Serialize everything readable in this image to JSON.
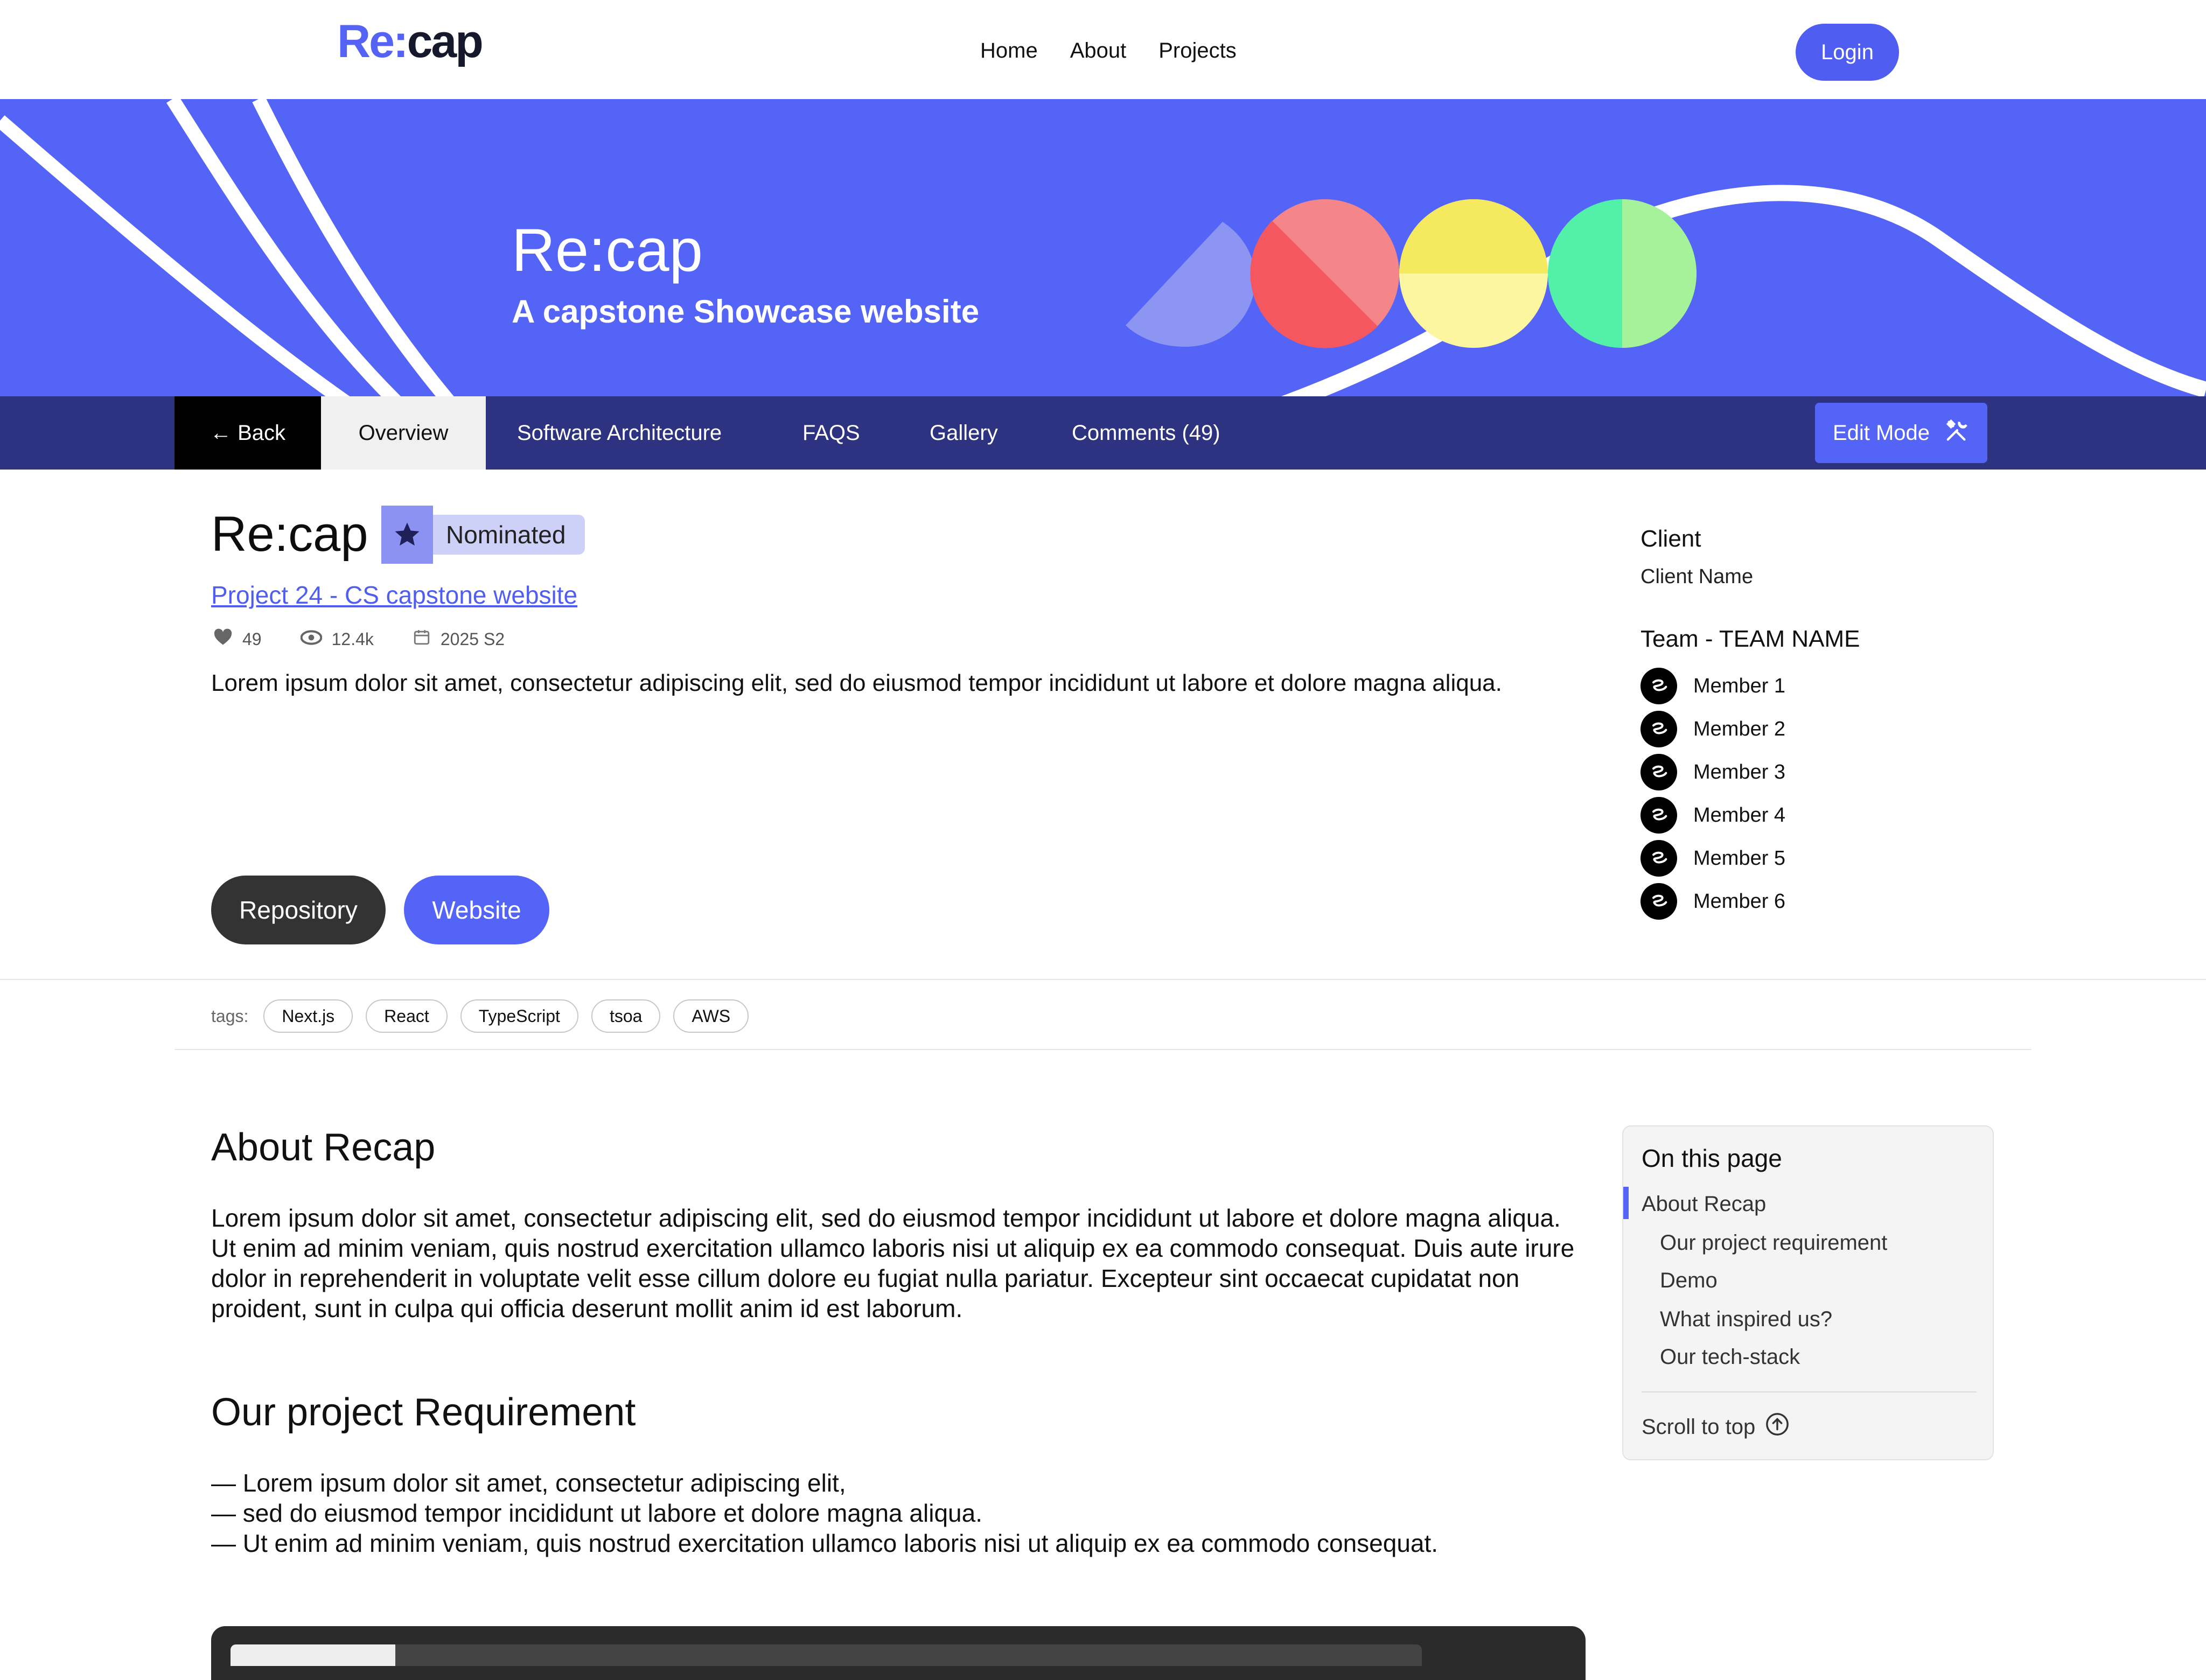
{
  "topnav": {
    "logo_re": "Re:",
    "logo_cap": "cap",
    "links": [
      "Home",
      "About",
      "Projects"
    ],
    "login_label": "Login"
  },
  "hero": {
    "title": "Re:cap",
    "subtitle": "A capstone Showcase website"
  },
  "tabs": {
    "back": "← Back",
    "items": [
      "Overview",
      "Software Architecture",
      "FAQS",
      "Gallery",
      "Comments (49)"
    ],
    "edit_label": "Edit Mode"
  },
  "project": {
    "title": "Re:cap",
    "badge": "Nominated",
    "link": "Project 24 - CS capstone website",
    "likes": "49",
    "views": "12.4k",
    "semester": "2025 S2",
    "description": "Lorem ipsum dolor sit amet, consectetur adipiscing elit, sed do eiusmod tempor incididunt ut labore et dolore magna aliqua.",
    "repo_label": "Repository",
    "website_label": "Website"
  },
  "sidebar": {
    "client_heading": "Client",
    "client_name": "Client Name",
    "team_heading": "Team - TEAM NAME",
    "members": [
      "Member 1",
      "Member 2",
      "Member 3",
      "Member 4",
      "Member 5",
      "Member 6"
    ]
  },
  "tags": {
    "label": "tags:",
    "items": [
      "Next.js",
      "React",
      "TypeScript",
      "tsoa",
      "AWS"
    ]
  },
  "content": {
    "about_heading": "About Recap",
    "about_text": "Lorem ipsum dolor sit amet, consectetur adipiscing elit, sed do eiusmod tempor incididunt ut labore et dolore magna aliqua. Ut enim ad minim veniam, quis nostrud exercitation ullamco laboris nisi ut aliquip ex ea commodo consequat. Duis aute irure dolor in reprehenderit in voluptate velit esse cillum dolore eu fugiat nulla pariatur. Excepteur sint occaecat cupidatat non proident, sunt in culpa qui officia deserunt mollit anim id est laborum.",
    "req_heading": "Our project Requirement",
    "req_items": [
      "— Lorem ipsum dolor sit amet, consectetur adipiscing elit,",
      "— sed do eiusmod tempor incididunt ut labore et dolore magna aliqua.",
      "— Ut enim ad minim veniam, quis nostrud exercitation ullamco laboris nisi ut aliquip ex ea commodo consequat."
    ]
  },
  "toc": {
    "heading": "On this page",
    "items": [
      "About Recap",
      "Our project requirement",
      "Demo",
      "What inspired us?",
      "Our tech-stack"
    ],
    "scroll_top": "Scroll to top"
  },
  "colors": {
    "accent": "#5464f6",
    "tabbar": "#2d3380",
    "circle_red": "#f4575f",
    "circle_yellow": "#f5e960",
    "circle_green": "#52f0a8"
  }
}
